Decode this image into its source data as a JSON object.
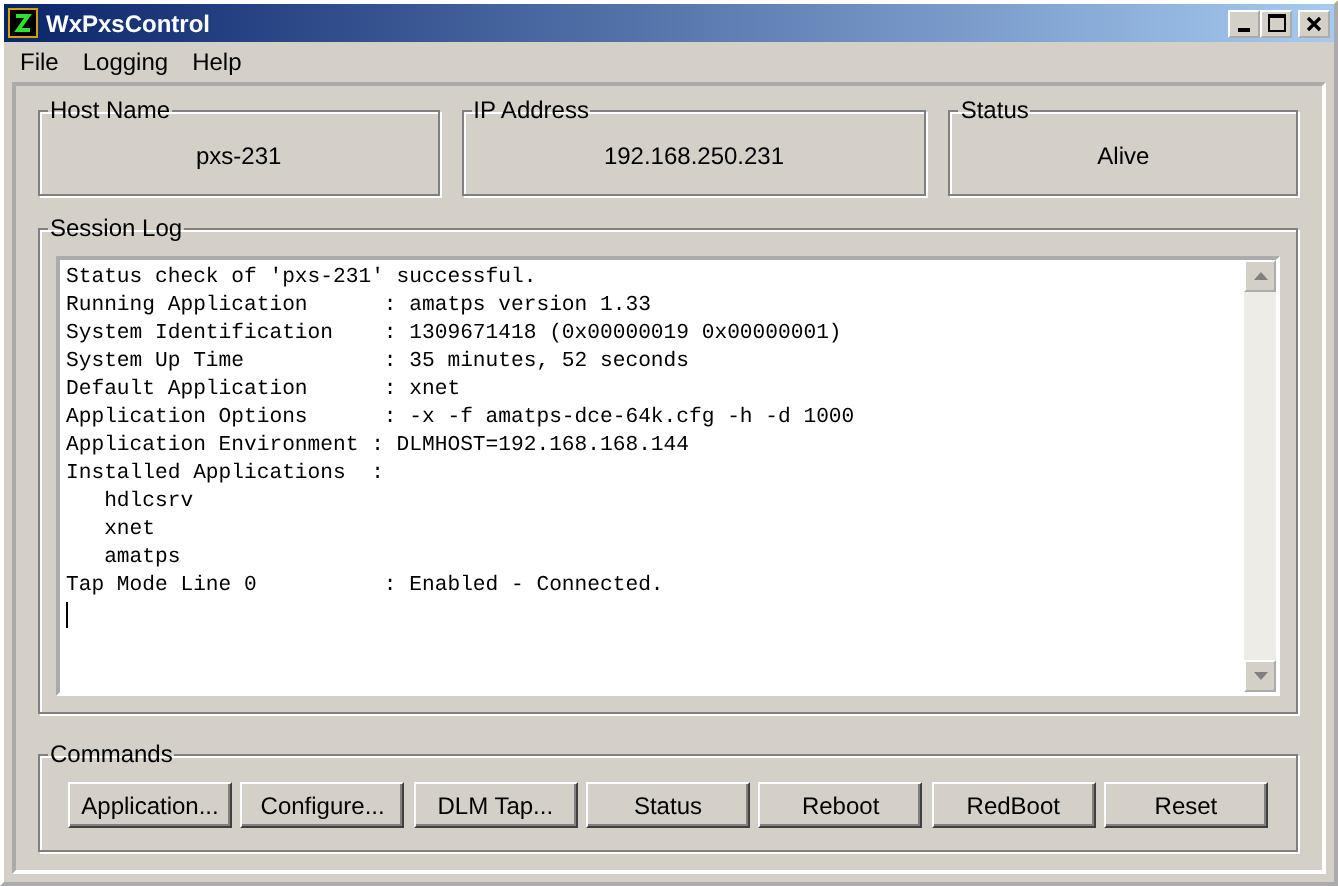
{
  "window": {
    "title": "WxPxsControl"
  },
  "menu": [
    "File",
    "Logging",
    "Help"
  ],
  "info_fields": [
    {
      "label": "Host Name",
      "value": "pxs-231"
    },
    {
      "label": "IP Address",
      "value": "192.168.250.231"
    },
    {
      "label": "Status",
      "value": "Alive"
    }
  ],
  "session_log": {
    "label": "Session Log",
    "lines": [
      "Status check of 'pxs-231' successful.",
      "Running Application      : amatps version 1.33",
      "System Identification    : 1309671418 (0x00000019 0x00000001)",
      "System Up Time           : 35 minutes, 52 seconds",
      "Default Application      : xnet",
      "Application Options      : -x -f amatps-dce-64k.cfg -h -d 1000",
      "Application Environment : DLMHOST=192.168.168.144",
      "Installed Applications  :",
      "   hdlcsrv",
      "   xnet",
      "   amatps",
      "Tap Mode Line 0          : Enabled - Connected."
    ]
  },
  "commands": {
    "label": "Commands",
    "buttons": [
      "Application...",
      "Configure...",
      "DLM Tap...",
      "Status",
      "Reboot",
      "RedBoot",
      "Reset"
    ]
  }
}
